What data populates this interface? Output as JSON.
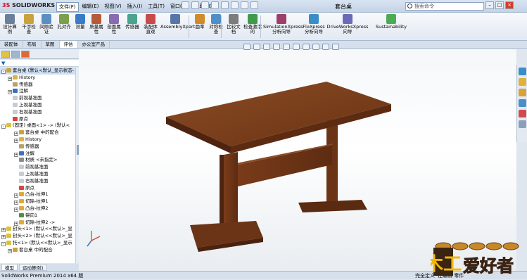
{
  "app": {
    "logo_prefix": "3S",
    "logo_text": "SOLIDWORKS",
    "doc_title": "套台桌",
    "status": "SolidWorks Premium 2014 x64 版",
    "status_mid": "完全定义",
    "status_right": "在编辑 零件"
  },
  "menu": [
    "文件(F)",
    "编辑(E)",
    "视图(V)",
    "插入(I)",
    "工具(T)",
    "窗口(W)",
    "帮助(H)"
  ],
  "search": {
    "placeholder": "搜索命令"
  },
  "ribbon": [
    {
      "label": "设计算例",
      "color": "#6a7f99"
    },
    {
      "label": "干涉检查",
      "color": "#c9a23b"
    },
    {
      "label": "间隙验证",
      "color": "#5b8fc4"
    },
    {
      "label": "孔对齐",
      "color": "#7b9f4d"
    },
    {
      "label": "测量",
      "color": "#3a7bc8"
    },
    {
      "label": "质量属性",
      "color": "#b65b3a"
    },
    {
      "label": "剖面属性",
      "color": "#8a6bb0"
    },
    {
      "label": "传感器",
      "color": "#4aa38f"
    },
    {
      "label": "装配体直观",
      "color": "#c94a4a"
    },
    {
      "label": "AssemblyXpert",
      "color": "#5676a8"
    },
    {
      "label": "曲率",
      "color": "#d28b2a"
    },
    {
      "label": "对称检查",
      "color": "#4f8fc9"
    },
    {
      "label": "比较文档",
      "color": "#7c7c7c"
    },
    {
      "label": "检查激活的",
      "color": "#3f9a4a"
    },
    {
      "label": "SimulationXpress 分析向导",
      "color": "#9e3e6a"
    },
    {
      "label": "FloXpress 分析向导",
      "color": "#3a8ec7"
    },
    {
      "label": "DriveWorksXpress 向导",
      "color": "#6a6ab8"
    },
    {
      "label": "Sustainability",
      "color": "#4caa52"
    }
  ],
  "tabs": [
    "装配体",
    "布局",
    "草图",
    "评估",
    "办公室产品"
  ],
  "active_tab": "评估",
  "tree": [
    {
      "label": "套台桌 (默认<默认_显示状态-",
      "indent": 0,
      "icon": "#caa23a",
      "exp": "-"
    },
    {
      "label": "History",
      "indent": 1,
      "icon": "#d8b34a",
      "exp": "+"
    },
    {
      "label": "传感器",
      "indent": 1,
      "icon": "#b9a06a",
      "exp": ""
    },
    {
      "label": "注解",
      "indent": 1,
      "icon": "#3a6fc4",
      "exp": "+"
    },
    {
      "label": "前视基准面",
      "indent": 1,
      "icon": "#c7ccd3",
      "exp": ""
    },
    {
      "label": "上视基准面",
      "indent": 1,
      "icon": "#c7ccd3",
      "exp": ""
    },
    {
      "label": "右视基准面",
      "indent": 1,
      "icon": "#c7ccd3",
      "exp": ""
    },
    {
      "label": "原点",
      "indent": 1,
      "icon": "#d6463a",
      "exp": ""
    },
    {
      "label": "(固定) 桌面<1> -> (默认<",
      "indent": 0,
      "icon": "#d9c23a",
      "exp": "-"
    },
    {
      "label": "套台桌 中的配合",
      "indent": 2,
      "icon": "#c9a23b",
      "exp": "+"
    },
    {
      "label": "History",
      "indent": 2,
      "icon": "#d8b34a",
      "exp": "+"
    },
    {
      "label": "传感器",
      "indent": 2,
      "icon": "#b9a06a",
      "exp": ""
    },
    {
      "label": "注解",
      "indent": 2,
      "icon": "#3a6fc4",
      "exp": "+"
    },
    {
      "label": "材质 <未指定>",
      "indent": 2,
      "icon": "#8c8c8c",
      "exp": ""
    },
    {
      "label": "前视基准面",
      "indent": 2,
      "icon": "#c7ccd3",
      "exp": ""
    },
    {
      "label": "上视基准面",
      "indent": 2,
      "icon": "#c7ccd3",
      "exp": ""
    },
    {
      "label": "右视基准面",
      "indent": 2,
      "icon": "#c7ccd3",
      "exp": ""
    },
    {
      "label": "原点",
      "indent": 2,
      "icon": "#d6463a",
      "exp": ""
    },
    {
      "label": "凸台-拉伸1",
      "indent": 2,
      "icon": "#e0a83a",
      "exp": "+"
    },
    {
      "label": "切除-拉伸1",
      "indent": 2,
      "icon": "#e0a83a",
      "exp": "+"
    },
    {
      "label": "凸台-拉伸2",
      "indent": 2,
      "icon": "#e0a83a",
      "exp": "+"
    },
    {
      "label": "镜向1",
      "indent": 2,
      "icon": "#4a8f4a",
      "exp": ""
    },
    {
      "label": "切除-拉伸2 ->",
      "indent": 2,
      "icon": "#e0a83a",
      "exp": "+"
    },
    {
      "label": "封头<1> (默认<<默认>_显",
      "indent": 0,
      "icon": "#d9c23a",
      "exp": "+"
    },
    {
      "label": "封头<2> (默认<<默认>_显",
      "indent": 0,
      "icon": "#d9c23a",
      "exp": "+"
    },
    {
      "label": "托<1> (默认<<默认>_显示",
      "indent": 0,
      "icon": "#d9c23a",
      "exp": "-"
    },
    {
      "label": "套台桌 中的配合",
      "indent": 1,
      "icon": "#c9a23b",
      "exp": "+"
    }
  ],
  "bottom_tabs": [
    "模型",
    "运动算例1"
  ],
  "watermark": {
    "text": "爱好者",
    "big": "木工",
    "colors": {
      "bg": "#3a2414",
      "text": "#e33a1e",
      "accent": "#f2b705"
    }
  }
}
